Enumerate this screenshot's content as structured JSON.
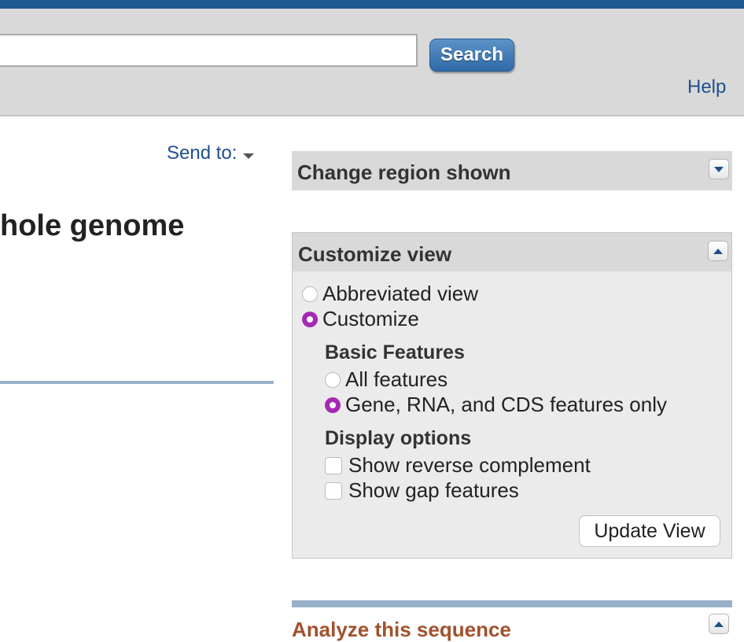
{
  "search": {
    "value": "",
    "button_label": "Search"
  },
  "header": {
    "help_label": "Help"
  },
  "send_to": {
    "label": "Send to:"
  },
  "page": {
    "title": "hole genome"
  },
  "panels": {
    "change_region": {
      "title": "Change region shown"
    },
    "customize_view": {
      "title": "Customize view",
      "view_options": [
        "Abbreviated view",
        "Customize"
      ],
      "selected_view": "Customize",
      "basic_features": {
        "heading": "Basic Features",
        "options": [
          "All features",
          "Gene, RNA, and CDS features only"
        ],
        "selected": "Gene, RNA, and CDS features only"
      },
      "display_options": {
        "heading": "Display options",
        "options": [
          "Show reverse complement",
          "Show gap features"
        ]
      },
      "update_label": "Update View"
    },
    "analyze": {
      "title": "Analyze this sequence"
    }
  },
  "colors": {
    "accent": "#a52ab3",
    "link": "#20508f",
    "topbar": "#1f5a92",
    "analyze_title": "#a0522d"
  }
}
